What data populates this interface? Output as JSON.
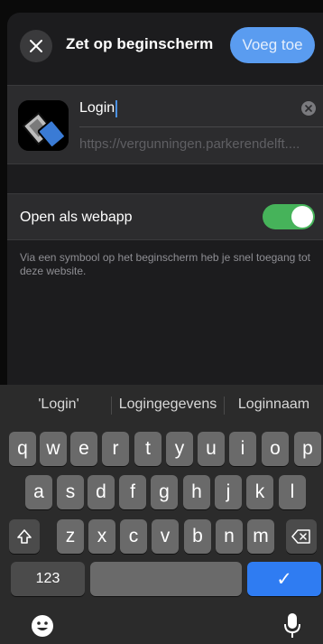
{
  "header": {
    "title": "Zet op beginscherm",
    "add_label": "Voeg toe"
  },
  "app": {
    "name": "Login",
    "url": "https://vergunningen.parkerendelft...."
  },
  "webapp": {
    "label": "Open als webapp",
    "enabled": true,
    "description": "Via een symbool op het beginscherm heb je snel toegang tot deze website."
  },
  "keyboard": {
    "suggestions": [
      "'Login'",
      "Logingegevens",
      "Loginnaam"
    ],
    "row1": [
      "q",
      "w",
      "e",
      "r",
      "t",
      "y",
      "u",
      "i",
      "o",
      "p"
    ],
    "row2": [
      "a",
      "s",
      "d",
      "f",
      "g",
      "h",
      "j",
      "k",
      "l"
    ],
    "row3": [
      "z",
      "x",
      "c",
      "v",
      "b",
      "n",
      "m"
    ],
    "numbers_label": "123",
    "return_symbol": "✓"
  },
  "colors": {
    "accent": "#5a9cf0",
    "toggle_on": "#46b35a",
    "return_key": "#2f7cf2"
  },
  "icons": [
    "close-icon",
    "clear-icon",
    "shift-icon",
    "backspace-icon",
    "emoji-icon",
    "microphone-icon"
  ]
}
